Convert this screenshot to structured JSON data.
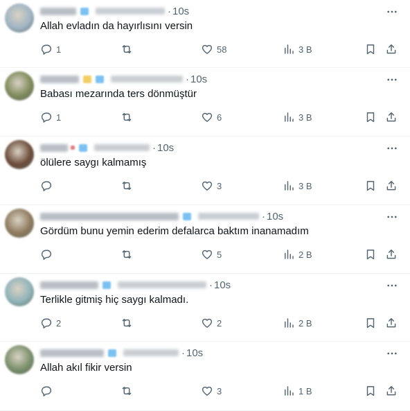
{
  "replies": [
    {
      "time": "10s",
      "text": "Allah evladın da hayırlısını versin",
      "replies_count": "1",
      "retweets": "",
      "likes": "58",
      "views": "3 B",
      "avatar_color": "#9fb4c4"
    },
    {
      "time": "10s",
      "text": "Babası mezarında ters dönmüştür",
      "replies_count": "1",
      "retweets": "",
      "likes": "6",
      "views": "3 B",
      "avatar_color": "#7e8a5a"
    },
    {
      "time": "10s",
      "text": "ölülere saygı kalmamış",
      "replies_count": "",
      "retweets": "",
      "likes": "3",
      "views": "3 B",
      "avatar_color": "#6b4a38"
    },
    {
      "time": "10s",
      "text": "Gördüm bunu yemin ederim defalarca baktım inanamadım",
      "replies_count": "",
      "retweets": "",
      "likes": "5",
      "views": "2 B",
      "avatar_color": "#8e7a5c"
    },
    {
      "time": "10s",
      "text": "Terlikle gitmiş hiç saygı kalmadı.",
      "replies_count": "2",
      "retweets": "",
      "likes": "2",
      "views": "2 B",
      "avatar_color": "#8fb3b8"
    },
    {
      "time": "10s",
      "text": "Allah akıl fikir versin",
      "replies_count": "",
      "retweets": "",
      "likes": "3",
      "views": "1 B",
      "avatar_color": "#7a8f6a"
    }
  ],
  "icons": {
    "reply": "reply-icon",
    "retweet": "retweet-icon",
    "like": "heart-icon",
    "views": "views-chart-icon",
    "bookmark": "bookmark-icon",
    "share": "share-icon",
    "more": "more-dots-icon"
  },
  "colors": {
    "text": "#0f1419",
    "secondary": "#536471",
    "divider": "#eff3f4",
    "verified": "#1d9bf0"
  }
}
